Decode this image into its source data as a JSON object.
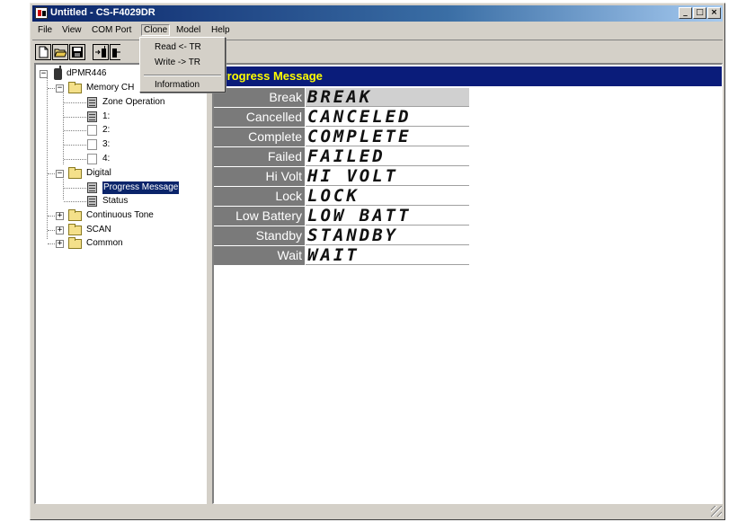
{
  "window": {
    "title": "Untitled - CS-F4029DR"
  },
  "menubar": {
    "items": [
      "File",
      "View",
      "COM Port",
      "Clone",
      "Model",
      "Help"
    ]
  },
  "clone_menu": {
    "items": [
      "Read <- TR",
      "Write -> TR",
      "Information"
    ]
  },
  "tree": {
    "root": "dPMR446",
    "memory_ch": "Memory CH",
    "zone_operation": "Zone Operation",
    "channels": [
      "1:",
      "2:",
      "3:",
      "4:"
    ],
    "digital": "Digital",
    "progress_message": "Progress Message",
    "status": "Status",
    "continuous_tone": "Continuous Tone",
    "scan": "SCAN",
    "common": "Common"
  },
  "panel": {
    "header": "Progress Message",
    "rows": [
      {
        "label": "Break",
        "value": "BREAK"
      },
      {
        "label": "Cancelled",
        "value": "CANCELED"
      },
      {
        "label": "Complete",
        "value": "COMPLETE"
      },
      {
        "label": "Failed",
        "value": "FAILED"
      },
      {
        "label": "Hi Volt",
        "value": "HI VOLT"
      },
      {
        "label": "Lock",
        "value": "LOCK"
      },
      {
        "label": "Low Battery",
        "value": "LOW BATT"
      },
      {
        "label": "Standby",
        "value": "STANDBY"
      },
      {
        "label": "Wait",
        "value": "WAIT"
      }
    ]
  },
  "colors": {
    "title_bar": "#0a246a",
    "panel_header_bg": "#0a1c7a",
    "panel_header_text": "#ffff00",
    "label_bg": "#7a7a7a",
    "selection": "#0a246a"
  },
  "icons": {
    "toolbar": [
      "new-file-icon",
      "open-folder-icon",
      "save-icon",
      "read-radio-icon",
      "write-radio-icon"
    ],
    "window_controls": [
      "minimize-icon",
      "maximize-icon",
      "close-icon"
    ]
  }
}
